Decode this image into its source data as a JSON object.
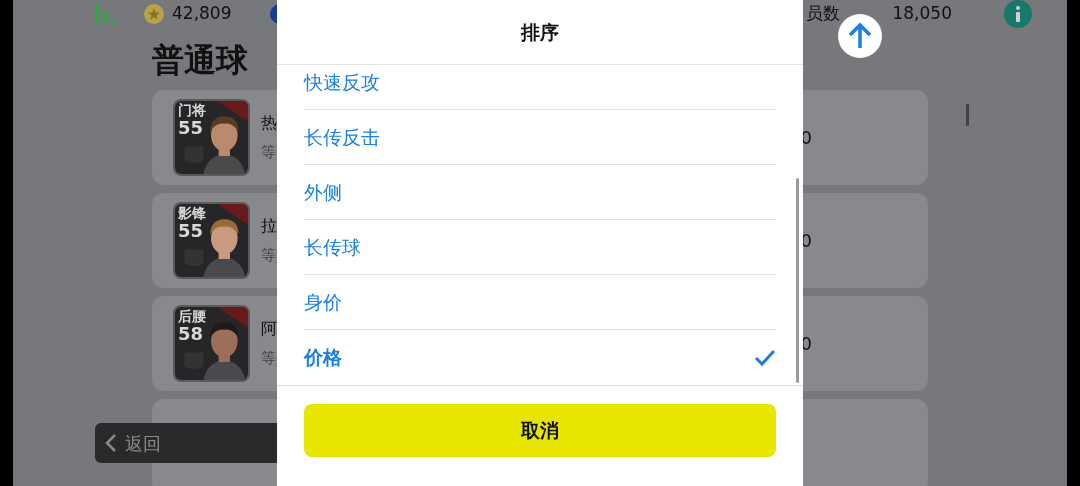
{
  "top_bar": {
    "coins": "42,809",
    "player_count_label": "员数",
    "player_count": "18,050"
  },
  "page_title": "普通球",
  "players": [
    {
      "position": "门将",
      "rating": "55",
      "name": "热",
      "detail": "等",
      "value": "0"
    },
    {
      "position": "影锋",
      "rating": "55",
      "name": "拉",
      "detail": "等",
      "value": "0"
    },
    {
      "position": "后腰",
      "rating": "58",
      "name": "阿",
      "detail": "等",
      "value": "0"
    }
  ],
  "back_button": "返回",
  "sort_dialog": {
    "title": "排序",
    "options": [
      {
        "label": "快速反攻",
        "selected": false
      },
      {
        "label": "长传反击",
        "selected": false
      },
      {
        "label": "外侧",
        "selected": false
      },
      {
        "label": "长传球",
        "selected": false
      },
      {
        "label": "身价",
        "selected": false
      },
      {
        "label": "价格",
        "selected": true
      }
    ],
    "cancel": "取消"
  }
}
